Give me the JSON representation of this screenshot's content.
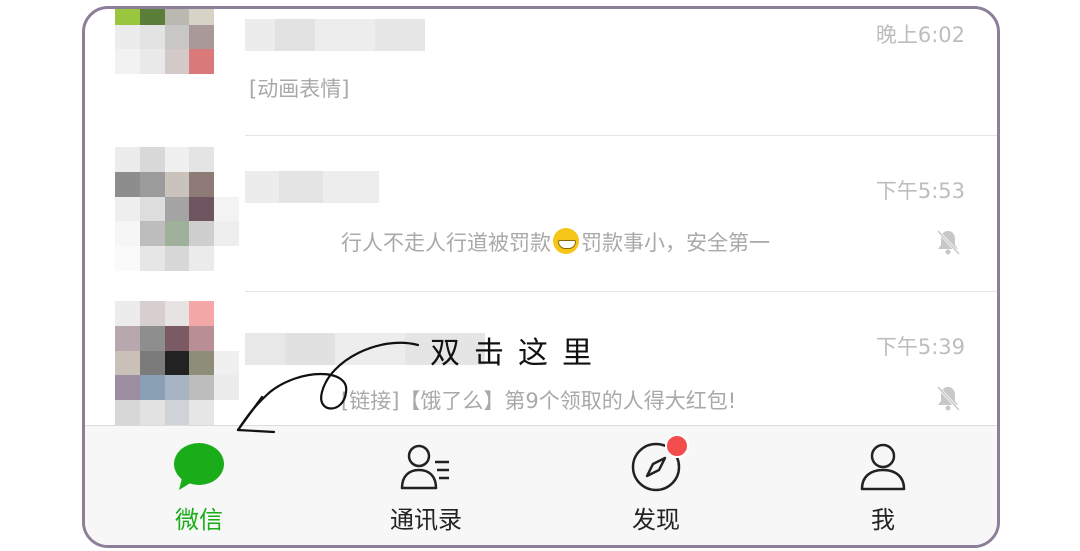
{
  "chats": [
    {
      "time": "晚上6:02",
      "preview": "[动画表情]",
      "muted": false
    },
    {
      "time": "下午5:53",
      "preview_before": "行人不走人行道被罚款",
      "preview_after": "罚款事小，安全第一",
      "emoji": "grinning-face",
      "muted": true
    },
    {
      "time": "下午5:39",
      "preview": "[链接]【饿了么】第9个领取的人得大红包!",
      "muted": true
    }
  ],
  "tabs": [
    {
      "label": "微信",
      "icon": "chat-bubble-icon",
      "active": true
    },
    {
      "label": "通讯录",
      "icon": "contacts-icon",
      "active": false
    },
    {
      "label": "发现",
      "icon": "compass-icon",
      "active": false,
      "badge": true
    },
    {
      "label": "我",
      "icon": "person-icon",
      "active": false
    }
  ],
  "annotation": {
    "text": "双击这里"
  },
  "colors": {
    "active_green": "#1aad19",
    "badge_red": "#f24c4c",
    "frame": "#8c7f99"
  }
}
